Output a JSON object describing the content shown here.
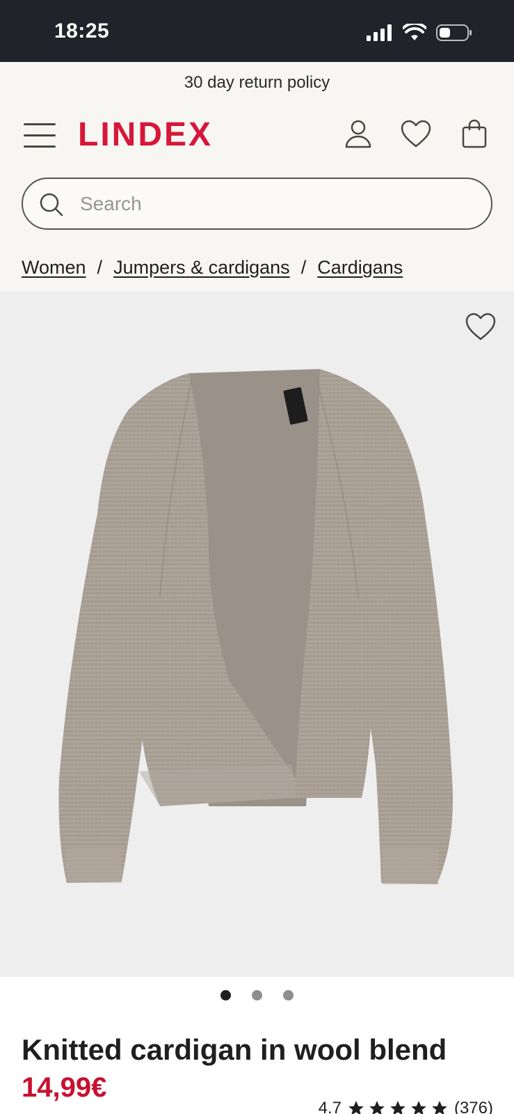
{
  "status_bar": {
    "time": "18:25"
  },
  "header": {
    "promo": "30 day return policy",
    "logo": "LINDEX",
    "icons": [
      "menu-icon",
      "account-icon",
      "heart-icon",
      "bag-icon"
    ]
  },
  "search": {
    "placeholder": "Search",
    "value": ""
  },
  "breadcrumb": {
    "items": [
      "Women",
      "Jumpers & cardigans",
      "Cardigans"
    ],
    "separator": "/"
  },
  "gallery": {
    "image_count": 3,
    "active_index": 0
  },
  "product": {
    "title": "Knitted cardigan in wool blend",
    "price": "14,99€",
    "rating": "4.7",
    "rating_stars": 5,
    "review_count": "(376)"
  },
  "colors": {
    "brand": "#d6173a",
    "price": "#c8102e",
    "header_bg": "#f8f6f3",
    "text": "#1f1f1f"
  }
}
